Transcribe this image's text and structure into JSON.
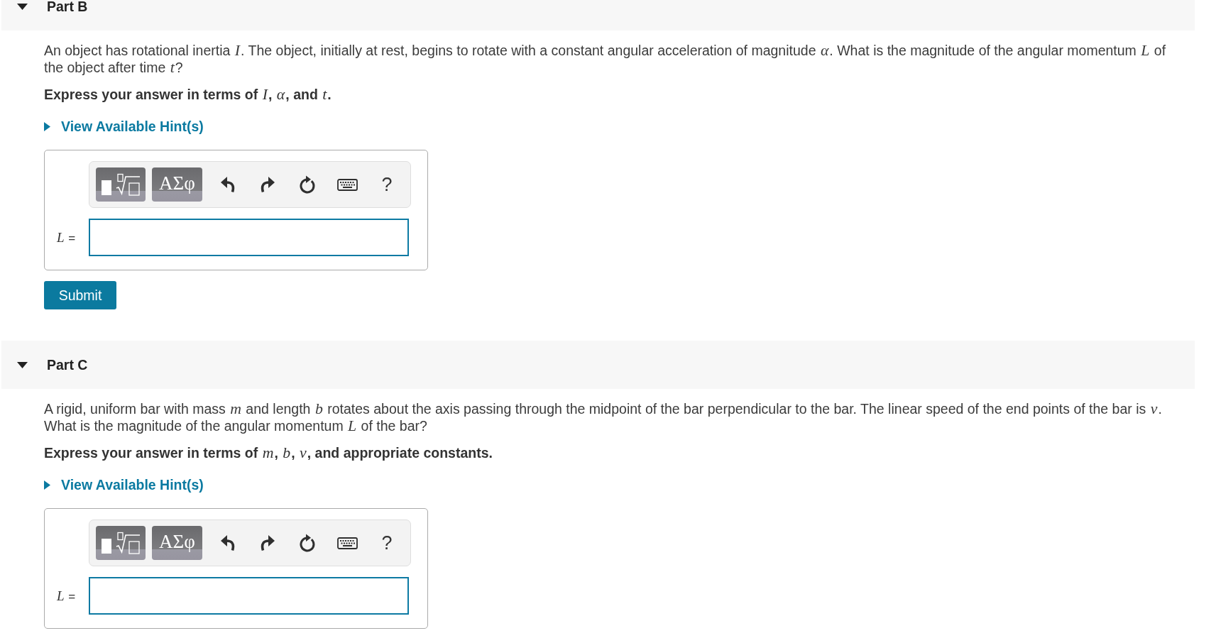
{
  "parts": [
    {
      "title": "Part B",
      "expanded": true,
      "question": "An object has rotational inertia *I*. The object, initially at rest, begins to rotate with a constant angular acceleration of magnitude *α*. What is the magnitude of the angular momentum *L* of the object after time *t*?",
      "instruction": "Express your answer in terms of *I*, *α*, and *t*.",
      "hints": {
        "label": "View Available Hint(s)",
        "expanded": false
      },
      "answer": {
        "label": "*L* =",
        "toolbar": {
          "symbols_button": "ΑΣφ",
          "help_button": "?"
        }
      },
      "submit_button": "Submit"
    },
    {
      "title": "Part C",
      "expanded": true,
      "question": "A rigid, uniform bar with mass *m* and length *b* rotates about the axis passing through the midpoint of the bar perpendicular to the bar. The linear speed of the end points of the bar is *v*. What is the magnitude of the angular momentum *L* of the bar?",
      "instruction": "Express your answer in terms of *m*, *b*, *v*, and appropriate constants.",
      "hints": {
        "label": "View Available Hint(s)",
        "expanded": false
      },
      "answer": {
        "label": "*L* =",
        "toolbar": {
          "symbols_button": "ΑΣφ",
          "help_button": "?"
        }
      }
    }
  ]
}
